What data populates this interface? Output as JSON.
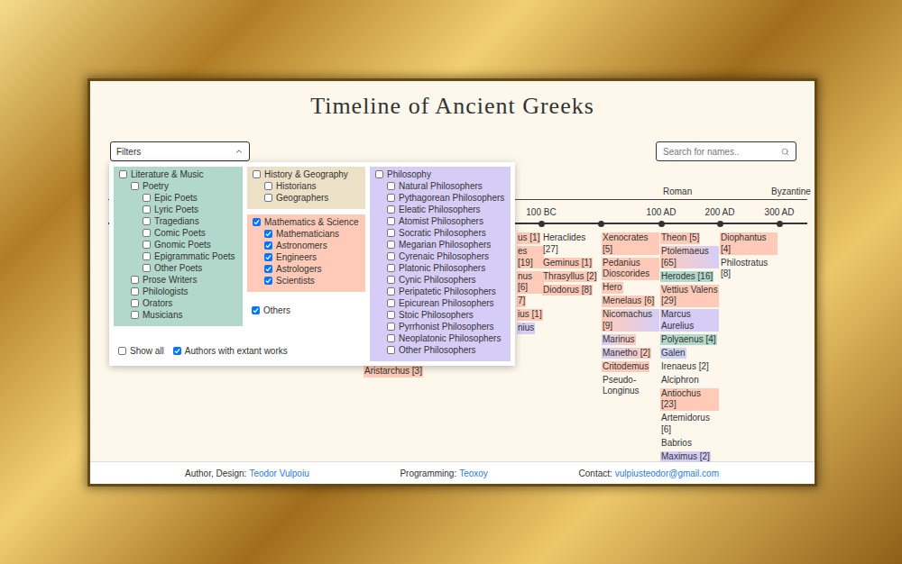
{
  "title": "Timeline of Ancient Greeks",
  "filters_button": {
    "label": "Filters",
    "expanded": true
  },
  "search": {
    "placeholder": "Search for names.."
  },
  "filters_panel": {
    "columns": [
      [
        {
          "kind": "panel",
          "label": "Literature & Music",
          "checked": false,
          "color": "#b2d8cc",
          "items": [
            {
              "label": "Poetry",
              "checked": false,
              "items": [
                {
                  "label": "Epic Poets",
                  "checked": false,
                  "items": []
                },
                {
                  "label": "Lyric Poets",
                  "checked": false,
                  "items": []
                },
                {
                  "label": "Tragedians",
                  "checked": false,
                  "items": []
                },
                {
                  "label": "Comic Poets",
                  "checked": false,
                  "items": []
                },
                {
                  "label": "Gnomic Poets",
                  "checked": false,
                  "items": []
                },
                {
                  "label": "Epigrammatic Poets",
                  "checked": false,
                  "items": []
                },
                {
                  "label": "Other Poets",
                  "checked": false,
                  "items": []
                }
              ]
            },
            {
              "label": "Prose Writers",
              "checked": false,
              "items": []
            },
            {
              "label": "Philologists",
              "checked": false,
              "items": []
            },
            {
              "label": "Orators",
              "checked": false,
              "items": []
            },
            {
              "label": "Musicians",
              "checked": false,
              "items": []
            }
          ]
        }
      ],
      [
        {
          "kind": "panel",
          "label": "History & Geography",
          "checked": false,
          "color": "#ece0c6",
          "items": [
            {
              "label": "Historians",
              "checked": false,
              "items": []
            },
            {
              "label": "Geographers",
              "checked": false,
              "items": []
            }
          ]
        },
        {
          "kind": "panel",
          "label": "Mathematics & Science",
          "checked": true,
          "color": "#ffcbb8",
          "items": [
            {
              "label": "Mathematicians",
              "checked": true,
              "items": []
            },
            {
              "label": "Astronomers",
              "checked": true,
              "items": []
            },
            {
              "label": "Engineers",
              "checked": true,
              "items": []
            },
            {
              "label": "Astrologers",
              "checked": true,
              "items": []
            },
            {
              "label": "Scientists",
              "checked": true,
              "items": []
            }
          ]
        },
        {
          "kind": "checkbox",
          "label": "Others",
          "checked": true,
          "items": []
        }
      ],
      [
        {
          "kind": "panel",
          "label": "Philosophy",
          "checked": false,
          "color": "#d6cdf7",
          "items": [
            {
              "label": "Natural Philosophers",
              "checked": false,
              "items": []
            },
            {
              "label": "Pythagorean Philosophers",
              "checked": false,
              "items": []
            },
            {
              "label": "Eleatic Philosophers",
              "checked": false,
              "items": []
            },
            {
              "label": "Atomist Philosophers",
              "checked": false,
              "items": []
            },
            {
              "label": "Socratic Philosophers",
              "checked": false,
              "items": []
            },
            {
              "label": "Megarian Philosophers",
              "checked": false,
              "items": []
            },
            {
              "label": "Cyrenaic Philosophers",
              "checked": false,
              "items": []
            },
            {
              "label": "Platonic Philosophers",
              "checked": false,
              "items": []
            },
            {
              "label": "Cynic Philosophers",
              "checked": false,
              "items": []
            },
            {
              "label": "Peripatetic Philosophers",
              "checked": false,
              "items": []
            },
            {
              "label": "Epicurean Philosophers",
              "checked": false,
              "items": []
            },
            {
              "label": "Stoic Philosophers",
              "checked": false,
              "items": []
            },
            {
              "label": "Pyrrhonist Philosophers",
              "checked": false,
              "items": []
            },
            {
              "label": "Neoplatonic Philosophers",
              "checked": false,
              "items": []
            },
            {
              "label": "Other Philosophers",
              "checked": false,
              "items": []
            }
          ]
        }
      ]
    ],
    "bottom": [
      {
        "label": "Show all",
        "checked": false
      },
      {
        "label": "Authors with extant works",
        "checked": true
      }
    ]
  },
  "timeline": {
    "eras": [
      "Roman",
      "Byzantine"
    ],
    "ticks": [
      "100 BC",
      "100 AD",
      "200 AD",
      "300 AD"
    ],
    "columns": [
      {
        "entries": [
          {
            "name": "Aristarchus [3]",
            "colors": [
              "#ffcbb8"
            ]
          }
        ]
      },
      {
        "entries": [
          {
            "name": "us [1]",
            "colors": [
              "#ffcbb8"
            ]
          },
          {
            "name": "es [19]",
            "colors": [
              "#ffcbb8"
            ]
          },
          {
            "name": "nus [6]",
            "colors": [
              "#ffcbb8"
            ]
          },
          {
            "name": "7]",
            "colors": [
              "#ffcbb8"
            ]
          },
          {
            "name": "ius [1]",
            "colors": [
              "#ffcbb8"
            ]
          },
          {
            "name": "nius",
            "colors": [
              "#d6cdf7"
            ]
          }
        ]
      },
      {
        "entries": [
          {
            "name": "Heraclides [27]",
            "colors": []
          },
          {
            "name": "Geminus [1]",
            "colors": [
              "#ffcbb8"
            ]
          },
          {
            "name": "Thrasyllus [2]",
            "colors": [
              "#ffcbb8"
            ]
          },
          {
            "name": "Diodorus [8]",
            "colors": [
              "#ffcbb8"
            ]
          }
        ]
      },
      {
        "entries": [
          {
            "name": "Xenocrates [5]",
            "colors": [
              "#ffcbb8"
            ]
          },
          {
            "name": "Pedanius Dioscorides",
            "colors": [
              "#ffcbb8"
            ]
          },
          {
            "name": "Hero",
            "colors": [
              "#ffcbb8"
            ]
          },
          {
            "name": "Menelaus [6]",
            "colors": [
              "#ffcbb8"
            ]
          },
          {
            "name": "Nicomachus [9]",
            "colors": [
              "#ffcbb8",
              "#d6cdf7"
            ]
          },
          {
            "name": "Marinus",
            "colors": [
              "#d6cdf7",
              "#ffcbb8"
            ]
          },
          {
            "name": "Manetho [2]",
            "colors": [
              "#d6cdf7",
              "#ffcbb8"
            ]
          },
          {
            "name": "Critodemus",
            "colors": [
              "#ffcbb8"
            ]
          },
          {
            "name": "Pseudo-Longinus",
            "colors": []
          }
        ]
      },
      {
        "entries": [
          {
            "name": "Theon [5]",
            "colors": [
              "#ffcbb8"
            ]
          },
          {
            "name": "Ptolemaeus [65]",
            "colors": [
              "#ffcbb8",
              "#d6cdf7"
            ]
          },
          {
            "name": "Herodes [16]",
            "colors": [
              "#b2d8cc"
            ]
          },
          {
            "name": "Vettius Valens [29]",
            "colors": [
              "#ffcbb8"
            ]
          },
          {
            "name": "Marcus Aurelius",
            "colors": [
              "#d6cdf7"
            ]
          },
          {
            "name": "Polyaenus [4]",
            "colors": [
              "#b2d8cc"
            ]
          },
          {
            "name": "Galen",
            "colors": [
              "#cdd3f7"
            ]
          },
          {
            "name": "Irenaeus [2]",
            "colors": []
          },
          {
            "name": "Alciphron",
            "colors": []
          },
          {
            "name": "Antiochus [23]",
            "colors": [
              "#ffcbb8"
            ]
          },
          {
            "name": "Artemidorus [6]",
            "colors": []
          },
          {
            "name": "Babrios",
            "colors": []
          },
          {
            "name": "Maximus [2]",
            "colors": [
              "#d6cdf7"
            ]
          }
        ]
      },
      {
        "entries": [
          {
            "name": "Diophantus [4]",
            "colors": [
              "#ffcbb8"
            ]
          },
          {
            "name": "Philostratus [8]",
            "colors": []
          }
        ]
      }
    ]
  },
  "footer": [
    {
      "label": "Author, Design:",
      "link": "Teodor Vulpoiu"
    },
    {
      "label": "Programming:",
      "link": "Teoxoy"
    },
    {
      "label": "Contact:",
      "link": "vulpiusteodor@gmail.com"
    }
  ]
}
